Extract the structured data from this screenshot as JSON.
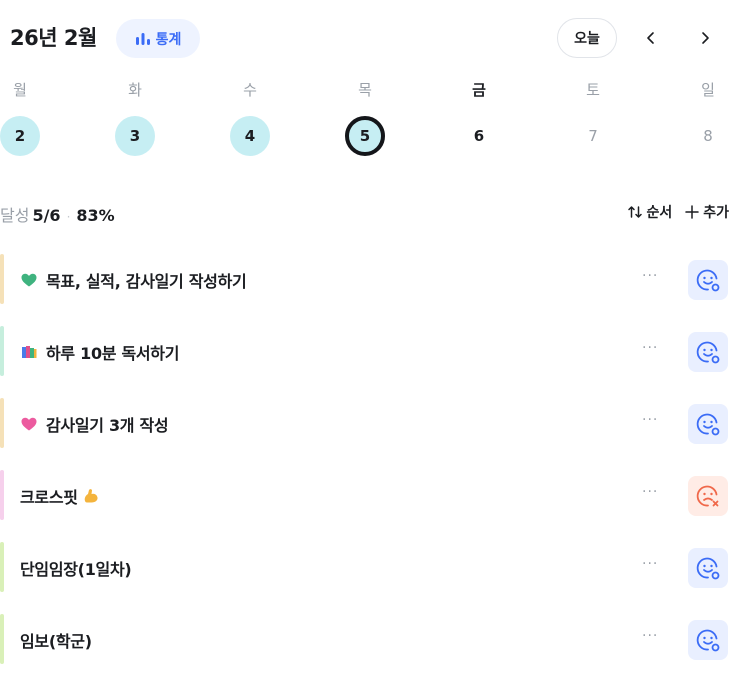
{
  "header": {
    "title": "26년 2월",
    "stats_label": "통계",
    "today_label": "오늘"
  },
  "week": [
    {
      "label": "월",
      "num": "2",
      "state": "done"
    },
    {
      "label": "화",
      "num": "3",
      "state": "done"
    },
    {
      "label": "수",
      "num": "4",
      "state": "done"
    },
    {
      "label": "목",
      "num": "5",
      "state": "selected"
    },
    {
      "label": "금",
      "num": "6",
      "state": "today"
    },
    {
      "label": "토",
      "num": "7",
      "state": "future"
    },
    {
      "label": "일",
      "num": "8",
      "state": "future"
    }
  ],
  "summary": {
    "label": "달성",
    "count": "5/6",
    "separator": "·",
    "percent": "83%"
  },
  "actions": {
    "order_label": "순서",
    "add_label": "추가"
  },
  "tasks": [
    {
      "title": "목표, 실적, 감사일기 작성하기",
      "emoji": "green-heart-icon",
      "bar_color": "#f5e1b8",
      "status": "good",
      "more": "···"
    },
    {
      "title": "하루 10분 독서하기",
      "emoji": "books-icon",
      "bar_color": "#c6eedd",
      "status": "good",
      "more": "···"
    },
    {
      "title": "감사일기 3개 작성",
      "emoji": "pink-heart-icon",
      "bar_color": "#f5e1b8",
      "status": "good",
      "more": "···"
    },
    {
      "title": "크로스핏",
      "emoji": "flexed-biceps-icon",
      "bar_color": "#f6d0ec",
      "status": "bad",
      "more": "···"
    },
    {
      "title": "단임임장(1일차)",
      "emoji": "",
      "bar_color": "#d9f0b8",
      "status": "good",
      "more": "···"
    },
    {
      "title": "임보(학군)",
      "emoji": "",
      "bar_color": "#d9f0b8",
      "status": "good",
      "more": "···"
    }
  ],
  "colors": {
    "accent": "#3b6cf6",
    "done_circle": "#c6eef3",
    "good_bg": "#e9efff",
    "bad_bg": "#ffece6",
    "bad_icon": "#f0684a"
  }
}
